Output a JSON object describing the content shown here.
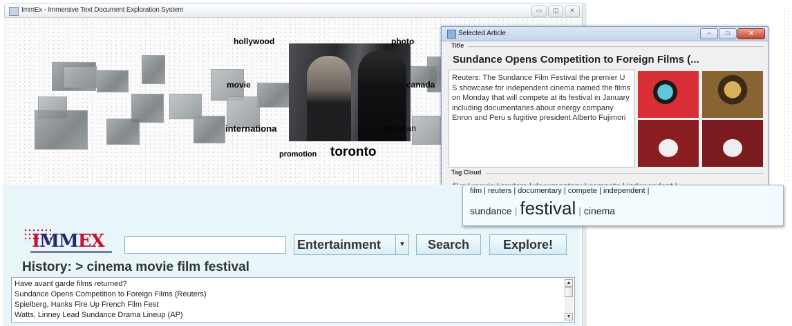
{
  "main_window": {
    "title": "ImmEx - Immersive Text Document Exploration System"
  },
  "tags": {
    "hollywood": "hollywood",
    "photo": "photo",
    "movie": "movie",
    "canada": "canada",
    "international": "internationa",
    "jonathan": "jonathan",
    "promotion": "promotion",
    "toronto": "toronto"
  },
  "article_window": {
    "title": "Selected Article",
    "title_section": "Title",
    "article_title": "Sundance Opens Competition to Foreign Films (...",
    "body": "Reuters:  The Sundance Film Festival the premier U S showcase for independent cinema named the films on Monday that will compete at its  festival in January including documentaries about energy company Enron and Peru s fugitive president Alberto Fujimori",
    "tag_cloud_section": "Tag Cloud",
    "garbled_line": "film | movie | reuters | documentary | compete | independent |"
  },
  "tag_cloud": {
    "top_line": "film | reuters | documentary | compete | independent |",
    "words": [
      {
        "text": "sundance",
        "size": "s"
      },
      {
        "text": "festival",
        "size": "l"
      },
      {
        "text": "cinema",
        "size": "s"
      }
    ],
    "separator": "|"
  },
  "logo": {
    "text_left": "I",
    "text_mid": "MM",
    "text_right": "EX"
  },
  "search": {
    "value": "",
    "placeholder": ""
  },
  "category_select": {
    "value": "Entertainment"
  },
  "buttons": {
    "search": "Search",
    "explore": "Explore!"
  },
  "history": {
    "label": "History: > cinema movie film festival"
  },
  "results": [
    "Have avant garde films returned?",
    "Sundance Opens Competition to Foreign Films (Reuters)",
    "Spielberg, Hanks Fire Up French Film Fest",
    "Watts, Linney Lead Sundance Drama Lineup (AP)"
  ],
  "icons": {
    "app": "window-app-icon",
    "article": "article-window-icon"
  }
}
